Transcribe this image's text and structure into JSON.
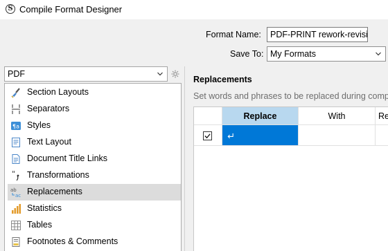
{
  "window": {
    "title": "Compile Format Designer"
  },
  "format_name": {
    "label": "Format Name:",
    "value": "PDF-PRINT rework-revision"
  },
  "save_to": {
    "label": "Save To:",
    "value": "My Formats"
  },
  "compile_for": {
    "value": "PDF"
  },
  "sidebar": {
    "items": [
      {
        "label": "Section Layouts",
        "icon": "paintbrush-icon"
      },
      {
        "label": "Separators",
        "icon": "separator-icon"
      },
      {
        "label": "Styles",
        "icon": "styles-icon"
      },
      {
        "label": "Text Layout",
        "icon": "text-layout-icon"
      },
      {
        "label": "Document Title Links",
        "icon": "document-icon"
      },
      {
        "label": "Transformations",
        "icon": "quotes-icon"
      },
      {
        "label": "Replacements",
        "icon": "replace-icon",
        "selected": true
      },
      {
        "label": "Statistics",
        "icon": "bar-chart-icon"
      },
      {
        "label": "Tables",
        "icon": "table-icon"
      },
      {
        "label": "Footnotes & Comments",
        "icon": "footnote-icon"
      }
    ]
  },
  "main": {
    "title": "Replacements",
    "description": "Set words and phrases to be replaced during compile.",
    "table": {
      "headers": [
        "Replace",
        "With",
        "Re"
      ],
      "row": {
        "checked": true,
        "replace": "",
        "with": ""
      }
    }
  },
  "colors": {
    "accent": "#0078d7",
    "header_highlight": "#b8d8ef",
    "selected_item": "#dcdcdc"
  }
}
